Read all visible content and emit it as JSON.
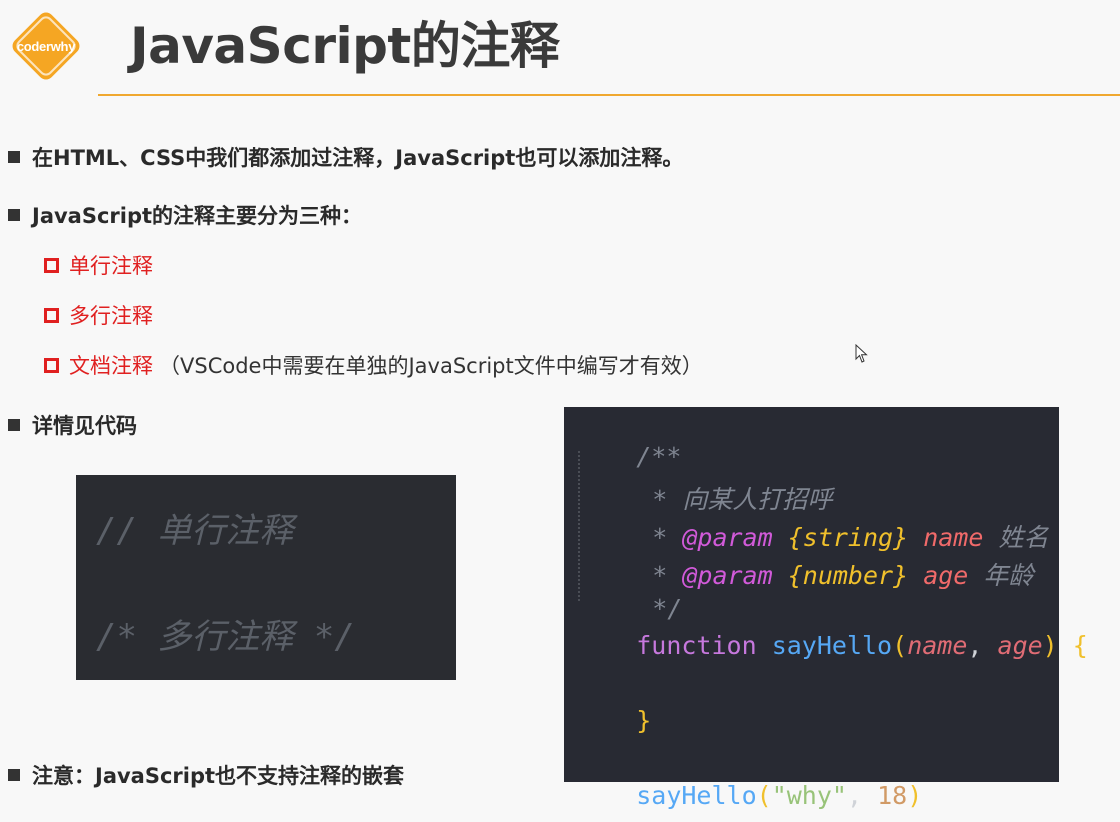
{
  "header": {
    "logo_text": "coderwhy",
    "title": "JavaScript的注释",
    "accent_color": "#f0a830"
  },
  "bullets": {
    "b1": "在HTML、CSS中我们都添加过注释，JavaScript也可以添加注释。",
    "b2": "JavaScript的注释主要分为三种：",
    "b3": "详情见代码",
    "b4": "注意：JavaScript也不支持注释的嵌套"
  },
  "types": [
    {
      "label": "单行注释",
      "note": ""
    },
    {
      "label": "多行注释",
      "note": ""
    },
    {
      "label": "文档注释",
      "note": "（VSCode中需要在单独的JavaScript文件中编写才有效）"
    }
  ],
  "code_left": {
    "line1": "// 单行注释",
    "line2": "/* 多行注释 */"
  },
  "code_right": {
    "doc_open": "/**",
    "doc_star": "*",
    "doc_desc": "向某人打招呼",
    "param_tag": "@param",
    "type1": "{string}",
    "pname1": "name",
    "pdesc1": "姓名",
    "type2": "{number}",
    "pname2": "age",
    "pdesc2": "年龄",
    "doc_close": "*/",
    "kw_function": "function",
    "fn_name": "sayHello",
    "open_paren": "(",
    "arg1": "name",
    "comma": ", ",
    "arg2": "age",
    "close_paren": ")",
    "open_brace": "{",
    "close_brace": "}",
    "call_open": "(",
    "call_str": "\"why\"",
    "call_num": "18",
    "call_close": ")"
  }
}
